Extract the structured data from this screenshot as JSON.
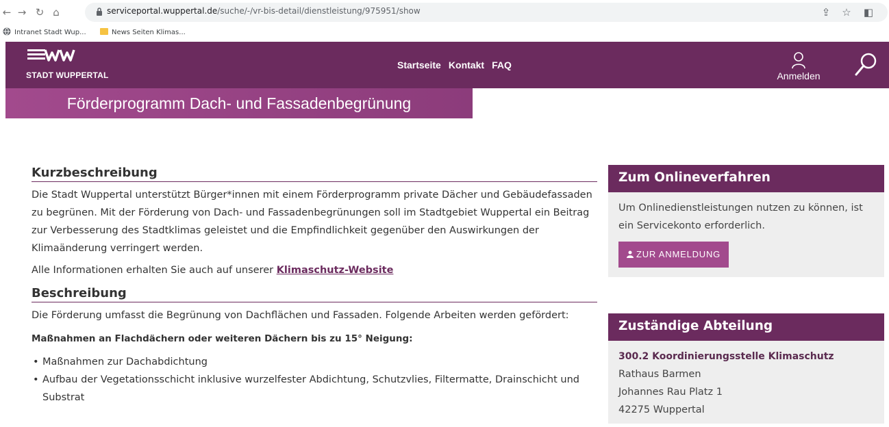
{
  "browser": {
    "url_host": "serviceportal.wuppertal.de",
    "url_path": "/suche/-/vr-bis-detail/dienstleistung/975951/show",
    "bookmarks": [
      "Intranet Stadt Wup...",
      "News Seiten Klimas..."
    ]
  },
  "header": {
    "logo_text": "STADT WUPPERTAL",
    "nav": [
      "Startseite",
      "Kontakt",
      "FAQ"
    ],
    "login_label": "Anmelden"
  },
  "page": {
    "title": "Förderprogramm Dach- und Fassadenbegrünung"
  },
  "main": {
    "kurz_heading": "Kurzbeschreibung",
    "kurz_text": "Die Stadt Wuppertal unterstützt Bürger*innen mit einem Förderprogramm private Dächer und Gebäudefassaden zu begrünen. Mit der Förderung von Dach- und Fassadenbegrünungen soll im Stadtgebiet Wuppertal ein Beitrag zur Verbesserung des Stadtklimas geleistet und die Empfindlichkeit gegenüber den Auswirkungen der Klimaänderung verringert werden.",
    "info_prefix": "Alle Informationen erhalten Sie auch auf unserer ",
    "info_link": "Klimaschutz-Website",
    "beschr_heading": "Beschreibung",
    "beschr_text": "Die Förderung umfasst die Begrünung von Dachflächen und Fassaden. Folgende Arbeiten werden gefördert:",
    "massnahmen_heading": "Maßnahmen an Flachdächern oder weiteren Dächern bis zu 15° Neigung:",
    "list": [
      "Maßnahmen zur Dachabdichtung",
      "Aufbau der Vegetationsschicht inklusive wurzelfester Abdichtung, Schutzvlies, Filtermatte, Drainschicht und Substrat"
    ]
  },
  "sidebar": {
    "online": {
      "heading": "Zum Onlineverfahren",
      "text": "Um Onlinedienstleistungen nutzen zu können, ist ein Servicekonto erforderlich.",
      "button": "ZUR ANMELDUNG"
    },
    "abteilung": {
      "heading": "Zuständige Abteilung",
      "name": "300.2 Koordinierungsstelle Klimaschutz",
      "line1": "Rathaus Barmen",
      "line2": "Johannes Rau Platz 1",
      "line3": "42275 Wuppertal"
    }
  },
  "colors": {
    "brand": "#6b2b5e",
    "accent": "#a24a8d"
  }
}
